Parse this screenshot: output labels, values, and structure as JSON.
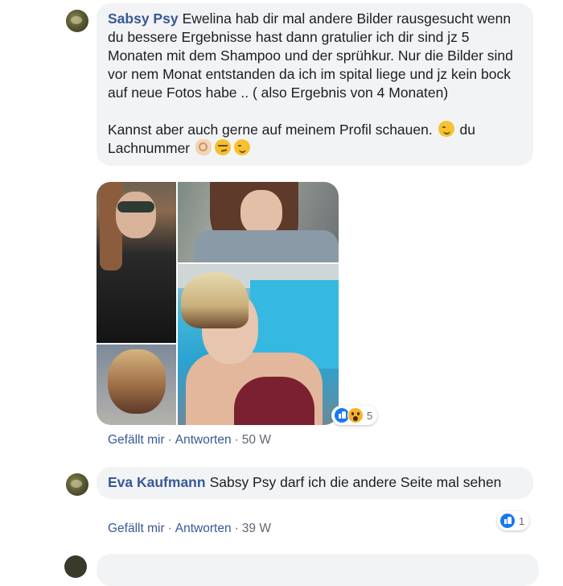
{
  "comment1": {
    "author": "Sabsy Psy",
    "text_p1": "Ewelina hab dir mal andere Bilder rausgesucht wenn du bessere Ergebnisse hast dann gratulier ich dir sind jz 5 Monaten mit dem Shampoo und der sprühkur. Nur die Bilder sind vor nem Monat entstanden da ich im spital liege und jz kein bock auf neue Fotos habe .. ( also Ergebnis von 4 Monaten)",
    "text_p2_a": "Kannst aber auch gerne auf meinem Profil schauen.",
    "text_p2_b": "du Lachnummer",
    "reactions": {
      "count": "5",
      "icons": [
        "like-icon",
        "wow-icon"
      ]
    },
    "actions": {
      "like": "Gefällt mir",
      "reply": "Antworten",
      "time": "50 W"
    }
  },
  "comment2": {
    "author": "Eva Kaufmann",
    "text": "Sabsy Psy darf ich die andere Seite mal sehen",
    "reactions": {
      "count": "1",
      "icons": [
        "like-icon"
      ]
    },
    "actions": {
      "like": "Gefällt mir",
      "reply": "Antworten",
      "time": "39 W"
    }
  },
  "separator": "·",
  "colors": {
    "link": "#385898",
    "bubble": "#f2f3f5",
    "meta": "#606770",
    "like": "#1877f2"
  }
}
